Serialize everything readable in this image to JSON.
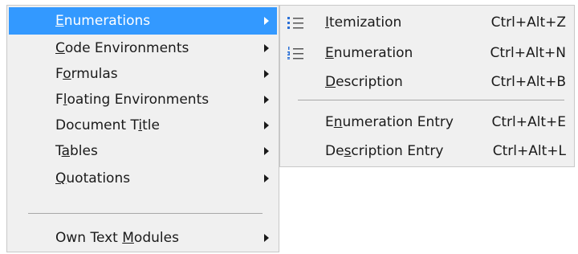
{
  "main_menu": {
    "items": [
      {
        "label": "Enumerations",
        "accel": "E",
        "rest": "numerations",
        "selected": true
      },
      {
        "label": "Code Environments",
        "accel": "C",
        "rest": "ode Environments"
      },
      {
        "label": "Formulas",
        "pre": "F",
        "accel": "o",
        "rest": "rmulas"
      },
      {
        "label": "Floating Environments",
        "pre": "F",
        "accel": "l",
        "rest": "oating Environments"
      },
      {
        "label": "Document Title",
        "pre": "Document T",
        "accel": "i",
        "rest": "tle"
      },
      {
        "label": "Tables",
        "pre": "T",
        "accel": "a",
        "rest": "bles"
      },
      {
        "label": "Quotations",
        "accel": "Q",
        "rest": "uotations"
      },
      {
        "label": "Own Text Modules",
        "pre": "Own Text ",
        "accel": "M",
        "rest": "odules"
      }
    ]
  },
  "sub_menu": {
    "items": [
      {
        "label": "Itemization",
        "accel": "I",
        "rest": "temization",
        "shortcut": "Ctrl+Alt+Z",
        "icon": "bullet-list-icon"
      },
      {
        "label": "Enumeration",
        "accel": "E",
        "rest": "numeration",
        "shortcut": "Ctrl+Alt+N",
        "icon": "numbered-list-icon"
      },
      {
        "label": "Description",
        "accel": "D",
        "rest": "escription",
        "shortcut": "Ctrl+Alt+B"
      },
      {
        "label": "Enumeration Entry",
        "pre": "E",
        "accel": "n",
        "rest": "umeration Entry",
        "shortcut": "Ctrl+Alt+E"
      },
      {
        "label": "Description Entry",
        "pre": "De",
        "accel": "s",
        "rest": "cription Entry",
        "shortcut": "Ctrl+Alt+L"
      }
    ]
  },
  "colors": {
    "selection": "#3399ff",
    "menu_bg": "#f0f0f0",
    "icon_blue": "#2a6fd6"
  }
}
